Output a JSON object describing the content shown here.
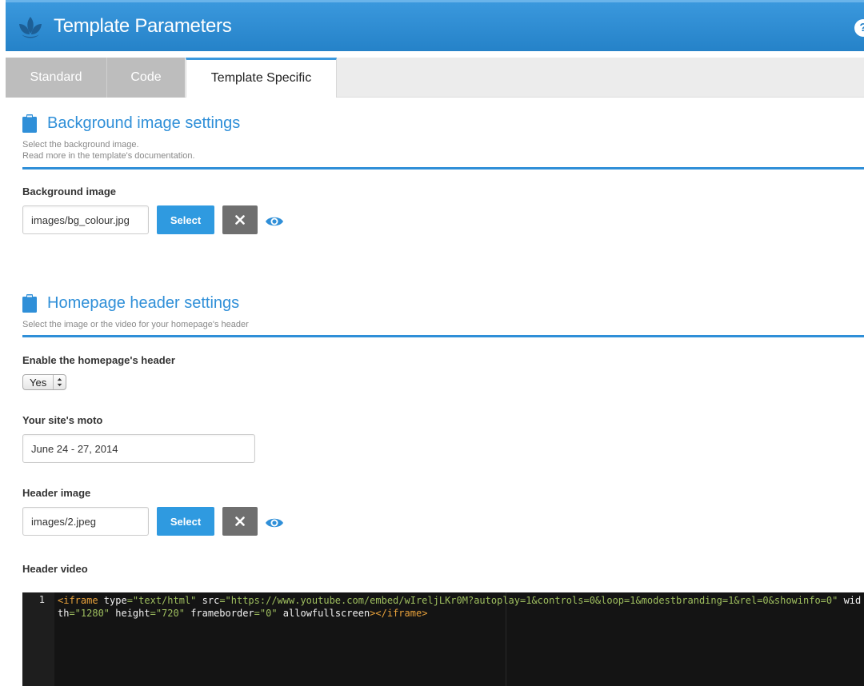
{
  "header": {
    "title": "Template Parameters",
    "help_label": "?",
    "logo_icon": "lotus-logo-icon",
    "accent_color": "#2582c8"
  },
  "tabs": [
    {
      "label": "Standard",
      "active": false
    },
    {
      "label": "Code",
      "active": false
    },
    {
      "label": "Template Specific",
      "active": true
    }
  ],
  "background_section": {
    "title": "Background image settings",
    "desc_line1": "Select the background image.",
    "desc_line2": "Read more in the template's documentation.",
    "icon": "clipboard-icon",
    "field_label": "Background image",
    "field_value": "images/bg_colour.jpg",
    "select_label": "Select"
  },
  "homepage_section": {
    "title": "Homepage header settings",
    "desc": "Select the image or the video for your homepage's header",
    "icon": "clipboard-icon",
    "enable_label": "Enable the homepage's header",
    "enable_value": "Yes",
    "moto_label": "Your site's moto",
    "moto_value": "June 24 - 27, 2014",
    "image_label": "Header image",
    "image_value": "images/2.jpeg",
    "select_label": "Select",
    "video_label": "Header video"
  },
  "code_editor": {
    "line_number": "1",
    "tokens": [
      {
        "t": "tag",
        "v": "<iframe "
      },
      {
        "t": "attr",
        "v": "type"
      },
      {
        "t": "val",
        "v": "=\"text/html\" "
      },
      {
        "t": "attr",
        "v": "src"
      },
      {
        "t": "val",
        "v": "=\"https://www.youtube.com/embed/wIreljLKr0M?autoplay=1&controls=0&loop=1&modestbranding=1&rel=0&showinfo=0\" "
      },
      {
        "t": "attr",
        "v": "width"
      },
      {
        "t": "val",
        "v": "=\"1280\" "
      },
      {
        "t": "attr",
        "v": "height"
      },
      {
        "t": "val",
        "v": "=\"720\" "
      },
      {
        "t": "attr",
        "v": "frameborder"
      },
      {
        "t": "val",
        "v": "=\"0\" "
      },
      {
        "t": "attr",
        "v": "allowfullscreen"
      },
      {
        "t": "tag",
        "v": "></iframe>"
      }
    ]
  }
}
